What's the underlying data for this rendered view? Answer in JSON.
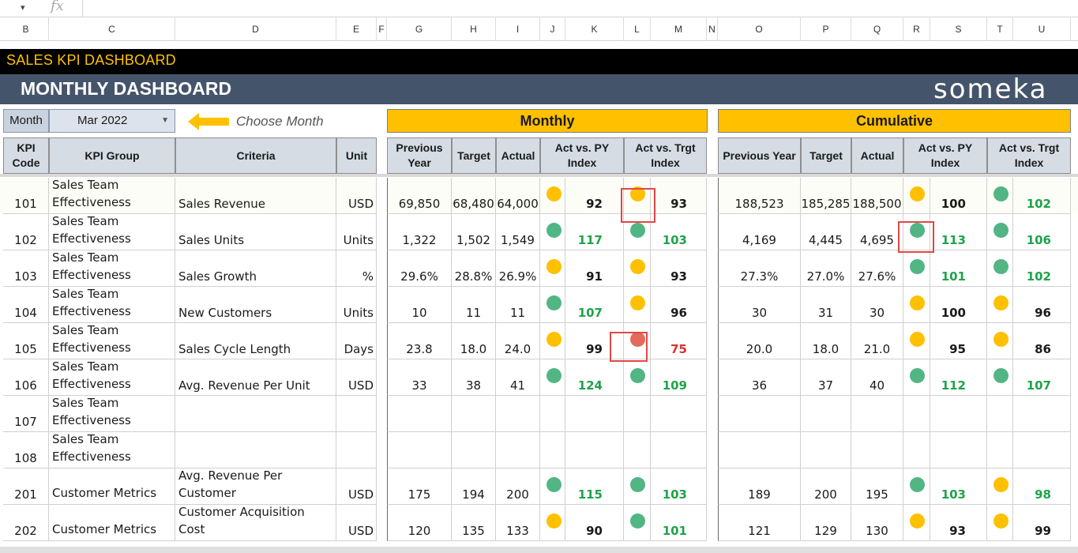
{
  "formula_bar": {
    "caret": "▾",
    "fx": "fx"
  },
  "columns": [
    "B",
    "C",
    "D",
    "E",
    "F",
    "G",
    "H",
    "I",
    "J",
    "K",
    "L",
    "M",
    "N",
    "O",
    "P",
    "Q",
    "R",
    "S",
    "T",
    "U"
  ],
  "title": "SALES KPI DASHBOARD",
  "subtitle": "MONTHLY DASHBOARD",
  "brand": "someka",
  "month_selector": {
    "label": "Month",
    "value": "Mar 2022",
    "hint": "Choose Month"
  },
  "groups": {
    "monthly": "Monthly",
    "cumulative": "Cumulative"
  },
  "headers": {
    "kpi_code": "KPI Code",
    "kpi_group": "KPI Group",
    "criteria": "Criteria",
    "unit": "Unit",
    "previous_year": "Previous Year",
    "target": "Target",
    "actual": "Actual",
    "act_vs_py": "Act vs. PY Index",
    "act_vs_trgt": "Act vs. Trgt Index"
  },
  "colors": {
    "yellow": "#ffc000",
    "green": "#52b584",
    "red": "#e36b5a",
    "green_text": "#1fa34a",
    "red_text": "#d9322e",
    "header_bg": "#44546a"
  },
  "rows": [
    {
      "code": "101",
      "group": "Sales Team Effectiveness",
      "criteria": "Sales Revenue",
      "unit": "USD",
      "m": {
        "py": "69,850",
        "target": "68,480",
        "actual": "64,000",
        "py_dot": "yellow",
        "py_idx": "92",
        "py_cls": "black",
        "tg_dot": "yellow",
        "tg_idx": "93",
        "tg_cls": "black"
      },
      "c": {
        "py": "188,523",
        "target": "185,285",
        "actual": "188,500",
        "py_dot": "yellow",
        "py_idx": "100",
        "py_cls": "black",
        "tg_dot": "green",
        "tg_idx": "102",
        "tg_cls": "green"
      }
    },
    {
      "code": "102",
      "group": "Sales Team Effectiveness",
      "criteria": "Sales Units",
      "unit": "Units",
      "m": {
        "py": "1,322",
        "target": "1,502",
        "actual": "1,549",
        "py_dot": "green",
        "py_idx": "117",
        "py_cls": "green",
        "tg_dot": "green",
        "tg_idx": "103",
        "tg_cls": "green"
      },
      "c": {
        "py": "4,169",
        "target": "4,445",
        "actual": "4,695",
        "py_dot": "green",
        "py_idx": "113",
        "py_cls": "green",
        "tg_dot": "green",
        "tg_idx": "106",
        "tg_cls": "green"
      }
    },
    {
      "code": "103",
      "group": "Sales Team Effectiveness",
      "criteria": "Sales Growth",
      "unit": "%",
      "m": {
        "py": "29.6%",
        "target": "28.8%",
        "actual": "26.9%",
        "py_dot": "yellow",
        "py_idx": "91",
        "py_cls": "black",
        "tg_dot": "yellow",
        "tg_idx": "93",
        "tg_cls": "black"
      },
      "c": {
        "py": "27.3%",
        "target": "27.0%",
        "actual": "27.6%",
        "py_dot": "green",
        "py_idx": "101",
        "py_cls": "green",
        "tg_dot": "green",
        "tg_idx": "102",
        "tg_cls": "green"
      }
    },
    {
      "code": "104",
      "group": "Sales Team Effectiveness",
      "criteria": "New Customers",
      "unit": "Units",
      "m": {
        "py": "10",
        "target": "11",
        "actual": "11",
        "py_dot": "green",
        "py_idx": "107",
        "py_cls": "green",
        "tg_dot": "yellow",
        "tg_idx": "96",
        "tg_cls": "black"
      },
      "c": {
        "py": "30",
        "target": "31",
        "actual": "30",
        "py_dot": "yellow",
        "py_idx": "100",
        "py_cls": "black",
        "tg_dot": "yellow",
        "tg_idx": "96",
        "tg_cls": "black"
      }
    },
    {
      "code": "105",
      "group": "Sales Team Effectiveness",
      "criteria": "Sales Cycle Length",
      "unit": "Days",
      "m": {
        "py": "23.8",
        "target": "18.0",
        "actual": "24.0",
        "py_dot": "yellow",
        "py_idx": "99",
        "py_cls": "black",
        "tg_dot": "red",
        "tg_idx": "75",
        "tg_cls": "red"
      },
      "c": {
        "py": "20.0",
        "target": "18.0",
        "actual": "21.0",
        "py_dot": "yellow",
        "py_idx": "95",
        "py_cls": "black",
        "tg_dot": "yellow",
        "tg_idx": "86",
        "tg_cls": "black"
      }
    },
    {
      "code": "106",
      "group": "Sales Team Effectiveness",
      "criteria": "Avg. Revenue Per Unit",
      "unit": "USD",
      "m": {
        "py": "33",
        "target": "38",
        "actual": "41",
        "py_dot": "green",
        "py_idx": "124",
        "py_cls": "green",
        "tg_dot": "green",
        "tg_idx": "109",
        "tg_cls": "green"
      },
      "c": {
        "py": "36",
        "target": "37",
        "actual": "40",
        "py_dot": "green",
        "py_idx": "112",
        "py_cls": "green",
        "tg_dot": "green",
        "tg_idx": "107",
        "tg_cls": "green"
      }
    },
    {
      "code": "107",
      "group": "Sales Team Effectiveness",
      "criteria": "",
      "unit": "",
      "m": null,
      "c": null
    },
    {
      "code": "108",
      "group": "Sales Team Effectiveness",
      "criteria": "",
      "unit": "",
      "m": null,
      "c": null
    },
    {
      "code": "201",
      "group": "Customer Metrics",
      "criteria": "Avg. Revenue Per Customer",
      "unit": "USD",
      "m": {
        "py": "175",
        "target": "194",
        "actual": "200",
        "py_dot": "green",
        "py_idx": "115",
        "py_cls": "green",
        "tg_dot": "green",
        "tg_idx": "103",
        "tg_cls": "green"
      },
      "c": {
        "py": "189",
        "target": "200",
        "actual": "195",
        "py_dot": "green",
        "py_idx": "103",
        "py_cls": "green",
        "tg_dot": "yellow",
        "tg_idx": "98",
        "tg_cls": "green"
      }
    },
    {
      "code": "202",
      "group": "Customer Metrics",
      "criteria": "Customer Acquisition Cost",
      "unit": "USD",
      "m": {
        "py": "120",
        "target": "135",
        "actual": "133",
        "py_dot": "yellow",
        "py_idx": "90",
        "py_cls": "black",
        "tg_dot": "green",
        "tg_idx": "101",
        "tg_cls": "green"
      },
      "c": {
        "py": "121",
        "target": "129",
        "actual": "130",
        "py_dot": "yellow",
        "py_idx": "93",
        "py_cls": "black",
        "tg_dot": "yellow",
        "tg_idx": "99",
        "tg_cls": "black"
      }
    }
  ]
}
